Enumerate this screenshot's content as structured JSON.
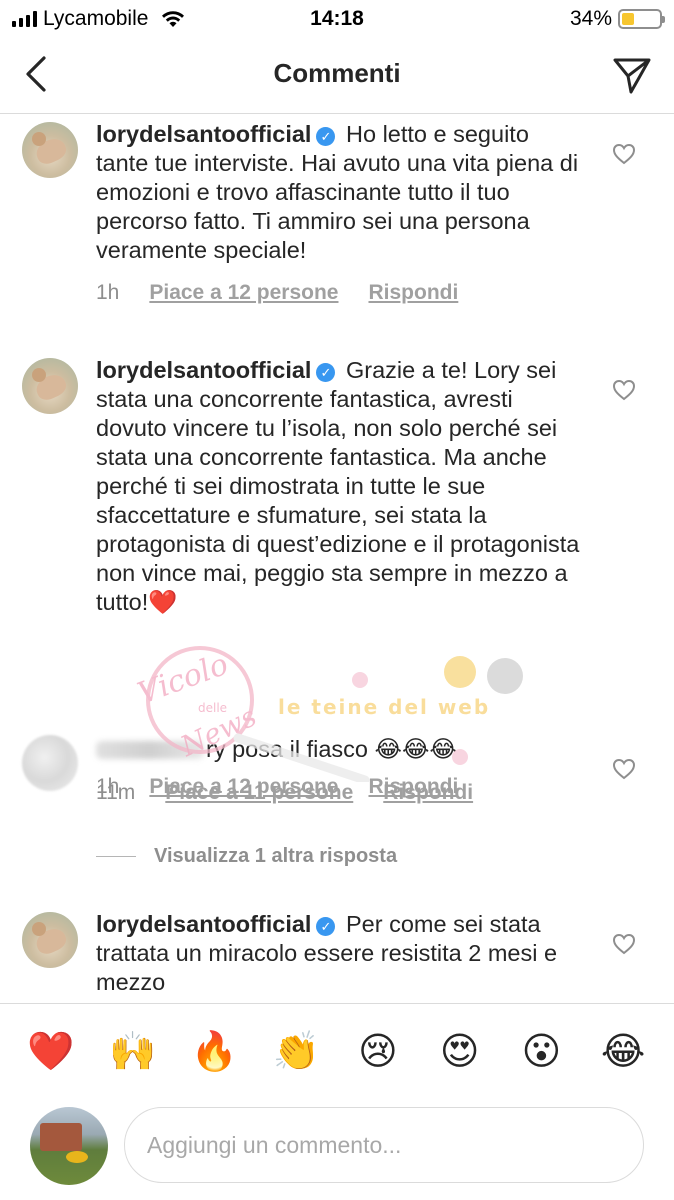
{
  "status_bar": {
    "carrier": "Lycamobile",
    "time": "14:18",
    "battery_percent": "34%",
    "battery_level": 0.34,
    "battery_color": "#f7c62f"
  },
  "header": {
    "title": "Commenti",
    "back_icon": "chevron-left-icon",
    "send_icon": "paper-plane-icon"
  },
  "comments": [
    {
      "username": "lorydelsantoofficial",
      "verified": true,
      "text": "Ho letto e seguito tante tue interviste. Hai avuto una vita piena di emozioni e trovo affascinante tutto il tuo percorso fatto. Ti ammiro sei una persona veramente speciale!",
      "time": "1h",
      "likes": "Piace a 12 persone",
      "reply": "Rispondi"
    },
    {
      "username": "lorydelsantoofficial",
      "verified": true,
      "text": "Grazie a te! Lory sei stata una concorrente fantastica, avresti dovuto vincere tu l’isola, non solo perché sei stata una concorrente fantastica. Ma anche perché ti sei dimostrata in tutte le sue sfaccettature e sfumature, sei stata la protagonista di quest’edizione e il protagonista non vince mai, peggio sta sempre in mezzo a tutto!❤️",
      "time": "1h",
      "likes": "Piace a 12 persone",
      "reply": "Rispondi"
    },
    {
      "username": "",
      "verified": false,
      "text": "ry posa il fiasco 😂😂😂",
      "time": "11m",
      "likes": "Piace a 11 persone",
      "reply": "Rispondi",
      "view_replies": "Visualizza 1 altra risposta"
    },
    {
      "username": "lorydelsantoofficial",
      "verified": true,
      "text": "Per come sei stata trattata un miracolo essere resistita 2 mesi e mezzo"
    }
  ],
  "watermark": {
    "line1": "Vicolo",
    "line2": "delle",
    "line3": "News",
    "line4": "le teine del web"
  },
  "emoji_bar": [
    "❤️",
    "🙌",
    "🔥",
    "👏",
    "😢",
    "😍",
    "😮",
    "😂"
  ],
  "composer": {
    "placeholder": "Aggiungi un commento..."
  }
}
